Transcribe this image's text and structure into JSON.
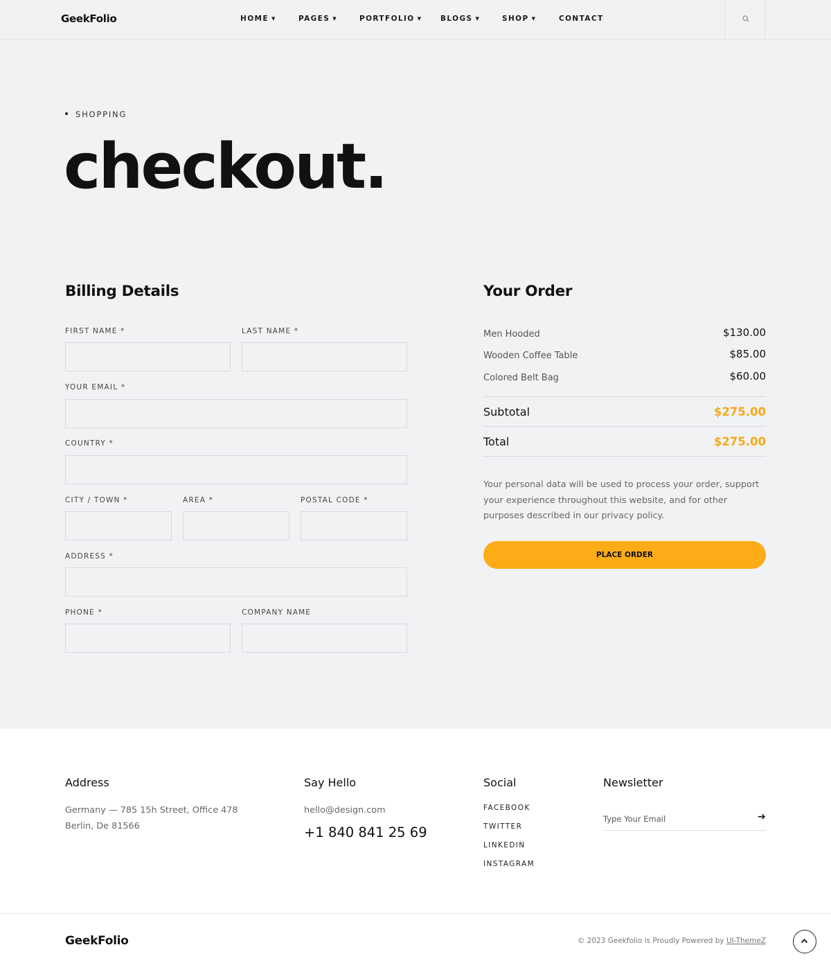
{
  "header": {
    "logo": "GeekFolio",
    "nav": [
      {
        "label": "HOME",
        "dropdown": true
      },
      {
        "label": "PAGES",
        "dropdown": true
      },
      {
        "label": "PORTFOLIO",
        "dropdown": true
      },
      {
        "label": "BLOGS",
        "dropdown": true
      },
      {
        "label": "SHOP",
        "dropdown": true
      },
      {
        "label": "CONTACT",
        "dropdown": false
      }
    ],
    "search_icon": "search-icon"
  },
  "hero": {
    "breadcrumb": "SHOPPING",
    "title": "checkout."
  },
  "billing": {
    "heading": "Billing Details",
    "fields": {
      "first_name": {
        "label": "FIRST NAME *",
        "value": ""
      },
      "last_name": {
        "label": "LAST NAME *",
        "value": ""
      },
      "email": {
        "label": "YOUR EMAIL *",
        "value": ""
      },
      "country": {
        "label": "COUNTRY *",
        "value": ""
      },
      "city": {
        "label": "CITY / TOWN *",
        "value": ""
      },
      "area": {
        "label": "AREA *",
        "value": ""
      },
      "postal": {
        "label": "POSTAL CODE *",
        "value": ""
      },
      "address": {
        "label": "ADDRESS *",
        "value": ""
      },
      "phone": {
        "label": "PHONE *",
        "value": ""
      },
      "company": {
        "label": "COMPANY NAME",
        "value": ""
      }
    }
  },
  "order": {
    "heading": "Your Order",
    "items": [
      {
        "name": "Men Hooded",
        "price": "$130.00"
      },
      {
        "name": "Wooden Coffee Table",
        "price": "$85.00"
      },
      {
        "name": "Colored Belt Bag",
        "price": "$60.00"
      }
    ],
    "subtotal_label": "Subtotal",
    "subtotal": "$275.00",
    "total_label": "Total",
    "total": "$275.00",
    "note": "Your personal data will be used to process your order, support your experience throughout this website, and for other purposes described in our privacy policy.",
    "button": "PLACE ORDER",
    "accent_color": "#fdab17"
  },
  "footer": {
    "address_heading": "Address",
    "address_line1": "Germany — 785 15h Street, Office 478",
    "address_line2": "Berlin, De 81566",
    "hello_heading": "Say Hello",
    "email": "hello@design.com",
    "phone": "+1 840 841 25 69",
    "social_heading": "Social",
    "social": [
      "FACEBOOK",
      "TWITTER",
      "LINKEDIN",
      "INSTAGRAM"
    ],
    "newsletter_heading": "Newsletter",
    "newsletter_placeholder": "Type Your Email",
    "logo": "GeekFolio",
    "copyright": "© 2023 Geekfolio is Proudly Powered by",
    "credit_link": "UI-ThemeZ"
  }
}
